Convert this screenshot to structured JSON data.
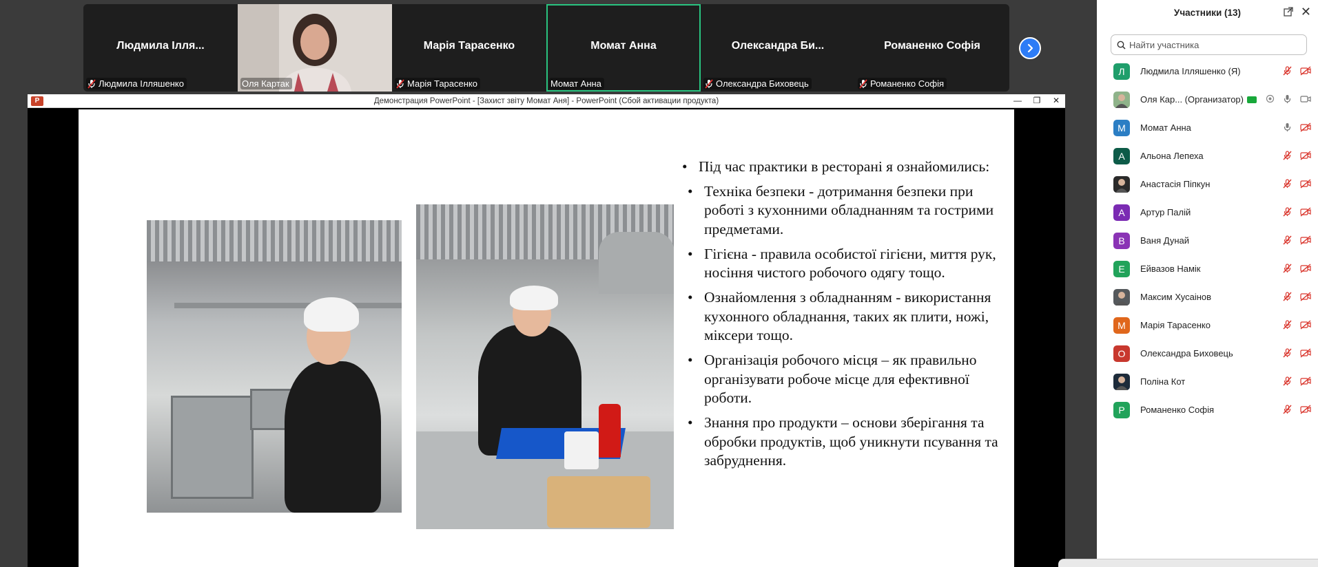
{
  "video_strip": {
    "tiles": [
      {
        "center_name": "Людмила Ілля...",
        "tag": "Людмила Ілляшенко",
        "muted": true,
        "video": false,
        "active": false
      },
      {
        "center_name": "",
        "tag": "Оля Картак",
        "muted": false,
        "video": true,
        "active": false
      },
      {
        "center_name": "Марія Тарасенко",
        "tag": "Марія Тарасенко",
        "muted": true,
        "video": false,
        "active": false
      },
      {
        "center_name": "Момат Анна",
        "tag": "Момат Анна",
        "muted": false,
        "video": false,
        "active": true
      },
      {
        "center_name": "Олександра Би...",
        "tag": "Олександра Биховець",
        "muted": true,
        "video": false,
        "active": false
      },
      {
        "center_name": "Романенко Софія",
        "tag": "Романенко Софія",
        "muted": true,
        "video": false,
        "active": false
      }
    ],
    "next_icon": "chevron-right-icon"
  },
  "powerpoint": {
    "app_badge": "P",
    "title": "Демонстрация PowerPoint - [Захист звіту Момат Аня] - PowerPoint (Сбой активации продукта)",
    "controls": [
      "—",
      "❐",
      "✕"
    ],
    "slide": {
      "intro": "Під час практики в ресторані я ознайомились:",
      "bullets": [
        "Техніка безпеки - дотримання безпеки при роботі з кухонними обладнанням та гострими предметами.",
        "Гігієна - правила особистої гігієни, миття рук, носіння чистого робочого одягу тощо.",
        "Ознайомлення з обладнанням - використання кухонного обладнання, таких як плити, ножі, міксери тощо.",
        "Організація робочого місця – як правильно організувати робоче місце для ефективної роботи.",
        " Знання про продукти – основи зберігання та обробки продуктів, щоб уникнути псування та забруднення."
      ]
    }
  },
  "participants": {
    "title": "Участники (13)",
    "search_placeholder": "Найти участника",
    "list": [
      {
        "initial": "Л",
        "color": "#1f9e6b",
        "name": "Людмила Ілляшенко (Я)",
        "mic": "muted",
        "cam": "off"
      },
      {
        "initial": "",
        "color": "#8fb38a",
        "name": "Оля Кар... (Организатор)",
        "mic": "on",
        "cam": "on",
        "photo": true,
        "sharing": true
      },
      {
        "initial": "М",
        "color": "#2b7ec4",
        "name": "Момат Анна",
        "mic": "on",
        "cam": "off"
      },
      {
        "initial": "А",
        "color": "#0d5b48",
        "name": "Альона Лепеха",
        "mic": "muted",
        "cam": "off"
      },
      {
        "initial": "",
        "color": "#2a2a2a",
        "name": "Анастасія Піпкун",
        "mic": "muted",
        "cam": "off",
        "photo": true
      },
      {
        "initial": "А",
        "color": "#7b2bb3",
        "name": "Артур Палій",
        "mic": "muted",
        "cam": "off"
      },
      {
        "initial": "В",
        "color": "#8a33b5",
        "name": "Ваня Дунай",
        "mic": "muted",
        "cam": "off"
      },
      {
        "initial": "Е",
        "color": "#21a35a",
        "name": "Ейвазов Намік",
        "mic": "muted",
        "cam": "off"
      },
      {
        "initial": "",
        "color": "#55595c",
        "name": "Максим Хусаінов",
        "mic": "muted",
        "cam": "off",
        "photo": true
      },
      {
        "initial": "М",
        "color": "#e0671c",
        "name": "Марія Тарасенко",
        "mic": "muted",
        "cam": "off"
      },
      {
        "initial": "О",
        "color": "#c8382e",
        "name": "Олександра Биховець",
        "mic": "muted",
        "cam": "off"
      },
      {
        "initial": "",
        "color": "#1d2b3a",
        "name": "Поліна Кот",
        "mic": "muted",
        "cam": "off",
        "photo": true
      },
      {
        "initial": "Р",
        "color": "#21a35a",
        "name": "Романенко Софія",
        "mic": "muted",
        "cam": "off"
      }
    ]
  }
}
